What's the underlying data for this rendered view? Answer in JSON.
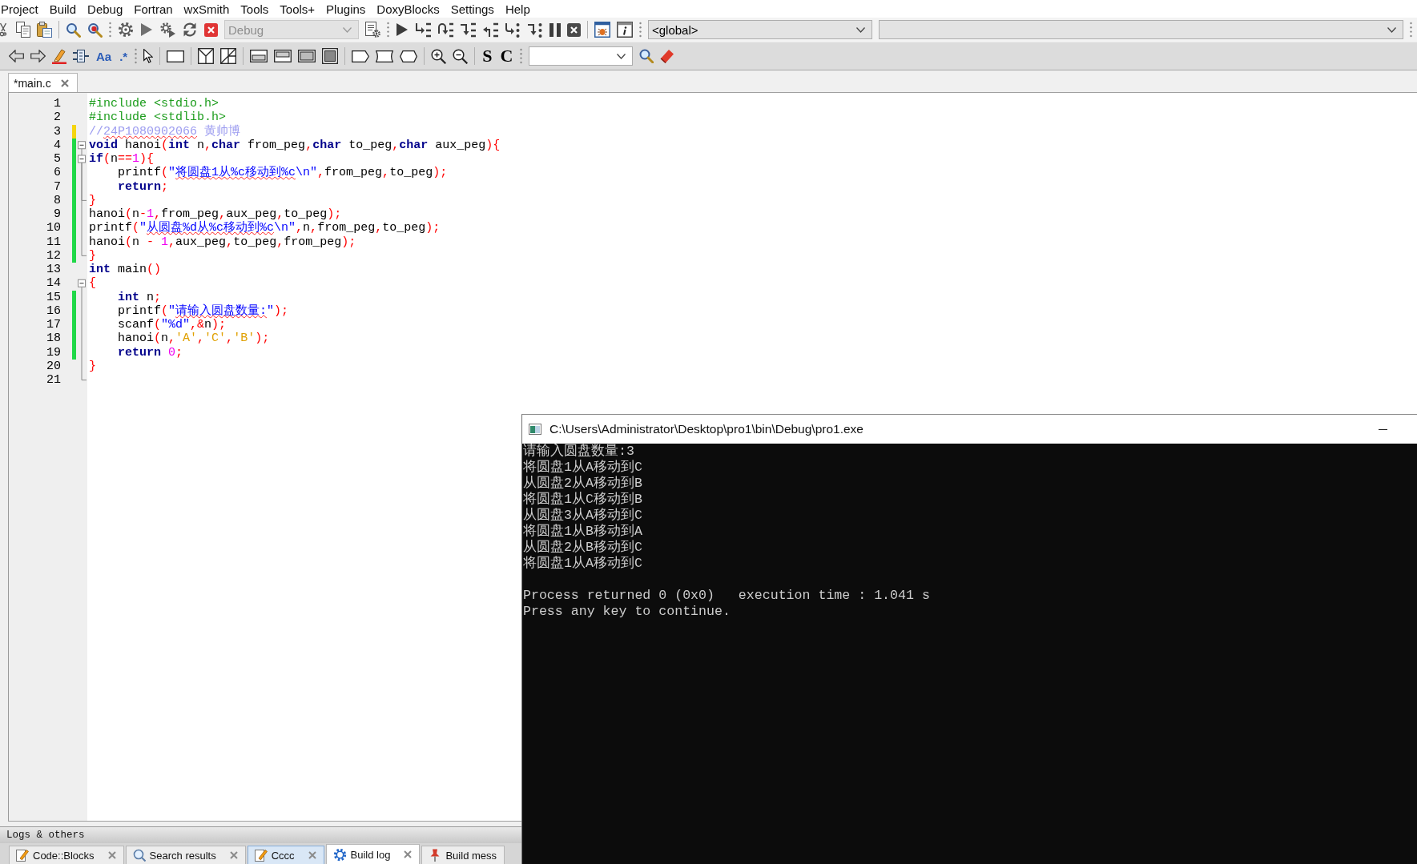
{
  "menu_bar": {
    "items": [
      "Project",
      "Build",
      "Debug",
      "Fortran",
      "wxSmith",
      "Tools",
      "Tools+",
      "Plugins",
      "DoxyBlocks",
      "Settings",
      "Help"
    ]
  },
  "main_toolbar": {
    "build_target": {
      "value": "Debug",
      "disabled": true
    },
    "scope_dropdown": {
      "value": "<global>",
      "disabled": false
    }
  },
  "search_toolbar": {
    "text_buttons": [
      "Aa",
      ".*",
      "S",
      "C"
    ]
  },
  "editor_tabs": [
    {
      "label": "*main.c",
      "selected": true
    }
  ],
  "editor": {
    "lines": [
      {
        "number": "1",
        "kind": "plain",
        "tokens": [
          {
            "kind": "preprocessor",
            "text": "#include <stdio.h>",
            "squiggle": false
          }
        ]
      },
      {
        "number": "2",
        "kind": "plain",
        "tokens": [
          {
            "kind": "preprocessor",
            "text": "#include <stdlib.h>",
            "squiggle": false
          }
        ]
      },
      {
        "number": "3",
        "kind": "plain",
        "change_bar": {
          "color": "#f5d50f"
        },
        "tokens": [
          {
            "kind": "comment",
            "text": "//",
            "squiggle": false
          },
          {
            "kind": "comment",
            "text": "24P1080902066",
            "squiggle": true
          },
          {
            "kind": "comment",
            "text": " 黄帅博",
            "squiggle": false
          }
        ]
      },
      {
        "number": "4",
        "kind": "opener",
        "change_bar": {
          "color": "#20d848"
        },
        "tokens": [
          {
            "kind": "keyword",
            "text": "void",
            "squiggle": false
          },
          {
            "kind": "plain",
            "text": " hanoi",
            "squiggle": false
          },
          {
            "kind": "operator",
            "text": "(",
            "squiggle": false
          },
          {
            "kind": "keyword",
            "text": "int",
            "squiggle": false
          },
          {
            "kind": "plain",
            "text": " n",
            "squiggle": false
          },
          {
            "kind": "operator",
            "text": ",",
            "squiggle": false
          },
          {
            "kind": "keyword",
            "text": "char",
            "squiggle": false
          },
          {
            "kind": "plain",
            "text": " from_peg",
            "squiggle": false
          },
          {
            "kind": "operator",
            "text": ",",
            "squiggle": false
          },
          {
            "kind": "keyword",
            "text": "char",
            "squiggle": false
          },
          {
            "kind": "plain",
            "text": " to_peg",
            "squiggle": false
          },
          {
            "kind": "operator",
            "text": ",",
            "squiggle": false
          },
          {
            "kind": "keyword",
            "text": "char",
            "squiggle": false
          },
          {
            "kind": "plain",
            "text": " aux_peg",
            "squiggle": false
          },
          {
            "kind": "operator",
            "text": "){",
            "squiggle": false
          }
        ]
      },
      {
        "number": "5",
        "kind": "opener",
        "change_bar": {
          "color": "#20d848"
        },
        "tokens": [
          {
            "kind": "keyword",
            "text": "if",
            "squiggle": false
          },
          {
            "kind": "operator",
            "text": "(",
            "squiggle": false
          },
          {
            "kind": "plain",
            "text": "n",
            "squiggle": false
          },
          {
            "kind": "operator",
            "text": "==",
            "squiggle": false
          },
          {
            "kind": "number",
            "text": "1",
            "squiggle": false
          },
          {
            "kind": "operator",
            "text": "){",
            "squiggle": false
          }
        ]
      },
      {
        "number": "6",
        "kind": "plain",
        "change_bar": {
          "color": "#20d848"
        },
        "tokens": [
          {
            "kind": "plain",
            "text": "    printf",
            "squiggle": false
          },
          {
            "kind": "operator",
            "text": "(",
            "squiggle": false
          },
          {
            "kind": "string",
            "text": "\"",
            "squiggle": false
          },
          {
            "kind": "string",
            "text": "将圆盘1从%c移动到%c",
            "squiggle": true
          },
          {
            "kind": "string",
            "text": "\\n\"",
            "squiggle": false
          },
          {
            "kind": "operator",
            "text": ",",
            "squiggle": false
          },
          {
            "kind": "plain",
            "text": "from_peg",
            "squiggle": false
          },
          {
            "kind": "operator",
            "text": ",",
            "squiggle": false
          },
          {
            "kind": "plain",
            "text": "to_peg",
            "squiggle": false
          },
          {
            "kind": "operator",
            "text": ");",
            "squiggle": false
          }
        ]
      },
      {
        "number": "7",
        "kind": "plain",
        "change_bar": {
          "color": "#20d848"
        },
        "tokens": [
          {
            "kind": "keyword",
            "text": "    return",
            "squiggle": false
          },
          {
            "kind": "operator",
            "text": ";",
            "squiggle": false
          }
        ]
      },
      {
        "number": "8",
        "kind": "closer",
        "change_bar": {
          "color": "#20d848"
        },
        "tokens": [
          {
            "kind": "operator",
            "text": "}",
            "squiggle": false
          }
        ]
      },
      {
        "number": "9",
        "kind": "plain",
        "change_bar": {
          "color": "#20d848"
        },
        "tokens": [
          {
            "kind": "plain",
            "text": "hanoi",
            "squiggle": false
          },
          {
            "kind": "operator",
            "text": "(",
            "squiggle": false
          },
          {
            "kind": "plain",
            "text": "n",
            "squiggle": false
          },
          {
            "kind": "operator",
            "text": "-",
            "squiggle": false
          },
          {
            "kind": "number",
            "text": "1",
            "squiggle": false
          },
          {
            "kind": "operator",
            "text": ",",
            "squiggle": false
          },
          {
            "kind": "plain",
            "text": "from_peg",
            "squiggle": false
          },
          {
            "kind": "operator",
            "text": ",",
            "squiggle": false
          },
          {
            "kind": "plain",
            "text": "aux_peg",
            "squiggle": false
          },
          {
            "kind": "operator",
            "text": ",",
            "squiggle": false
          },
          {
            "kind": "plain",
            "text": "to_peg",
            "squiggle": false
          },
          {
            "kind": "operator",
            "text": ");",
            "squiggle": false
          }
        ]
      },
      {
        "number": "10",
        "kind": "plain",
        "change_bar": {
          "color": "#20d848"
        },
        "tokens": [
          {
            "kind": "plain",
            "text": "printf",
            "squiggle": false
          },
          {
            "kind": "operator",
            "text": "(",
            "squiggle": false
          },
          {
            "kind": "string",
            "text": "\"",
            "squiggle": false
          },
          {
            "kind": "string",
            "text": "从圆盘%d从%c移动到%c",
            "squiggle": true
          },
          {
            "kind": "string",
            "text": "\\n\"",
            "squiggle": false
          },
          {
            "kind": "operator",
            "text": ",",
            "squiggle": false
          },
          {
            "kind": "plain",
            "text": "n",
            "squiggle": false
          },
          {
            "kind": "operator",
            "text": ",",
            "squiggle": false
          },
          {
            "kind": "plain",
            "text": "from_peg",
            "squiggle": false
          },
          {
            "kind": "operator",
            "text": ",",
            "squiggle": false
          },
          {
            "kind": "plain",
            "text": "to_peg",
            "squiggle": false
          },
          {
            "kind": "operator",
            "text": ");",
            "squiggle": false
          }
        ]
      },
      {
        "number": "11",
        "kind": "plain",
        "change_bar": {
          "color": "#20d848"
        },
        "tokens": [
          {
            "kind": "plain",
            "text": "hanoi",
            "squiggle": false
          },
          {
            "kind": "operator",
            "text": "(",
            "squiggle": false
          },
          {
            "kind": "plain",
            "text": "n ",
            "squiggle": false
          },
          {
            "kind": "operator",
            "text": "-",
            "squiggle": false
          },
          {
            "kind": "number",
            "text": " 1",
            "squiggle": false
          },
          {
            "kind": "operator",
            "text": ",",
            "squiggle": false
          },
          {
            "kind": "plain",
            "text": "aux_peg",
            "squiggle": false
          },
          {
            "kind": "operator",
            "text": ",",
            "squiggle": false
          },
          {
            "kind": "plain",
            "text": "to_peg",
            "squiggle": false
          },
          {
            "kind": "operator",
            "text": ",",
            "squiggle": false
          },
          {
            "kind": "plain",
            "text": "from_peg",
            "squiggle": false
          },
          {
            "kind": "operator",
            "text": ");",
            "squiggle": false
          }
        ]
      },
      {
        "number": "12",
        "kind": "closer",
        "change_bar": {
          "color": "#20d848"
        },
        "tokens": [
          {
            "kind": "operator",
            "text": "}",
            "squiggle": false
          }
        ]
      },
      {
        "number": "13",
        "kind": "plain",
        "tokens": [
          {
            "kind": "keyword",
            "text": "int",
            "squiggle": false
          },
          {
            "kind": "plain",
            "text": " main",
            "squiggle": false
          },
          {
            "kind": "operator",
            "text": "()",
            "squiggle": false
          }
        ]
      },
      {
        "number": "14",
        "kind": "opener",
        "tokens": [
          {
            "kind": "operator",
            "text": "{",
            "squiggle": false
          }
        ]
      },
      {
        "number": "15",
        "kind": "plain",
        "change_bar": {
          "color": "#20d848"
        },
        "tokens": [
          {
            "kind": "keyword",
            "text": "    int",
            "squiggle": false
          },
          {
            "kind": "plain",
            "text": " n",
            "squiggle": false
          },
          {
            "kind": "operator",
            "text": ";",
            "squiggle": false
          }
        ]
      },
      {
        "number": "16",
        "kind": "plain",
        "change_bar": {
          "color": "#20d848"
        },
        "tokens": [
          {
            "kind": "plain",
            "text": "    printf",
            "squiggle": false
          },
          {
            "kind": "operator",
            "text": "(",
            "squiggle": false
          },
          {
            "kind": "string",
            "text": "\"",
            "squiggle": false
          },
          {
            "kind": "string",
            "text": "请输入圆盘数量:",
            "squiggle": true
          },
          {
            "kind": "string",
            "text": "\"",
            "squiggle": false
          },
          {
            "kind": "operator",
            "text": ");",
            "squiggle": false
          }
        ]
      },
      {
        "number": "17",
        "kind": "plain",
        "change_bar": {
          "color": "#20d848"
        },
        "tokens": [
          {
            "kind": "plain",
            "text": "    scanf",
            "squiggle": false
          },
          {
            "kind": "operator",
            "text": "(",
            "squiggle": false
          },
          {
            "kind": "string",
            "text": "\"%d\"",
            "squiggle": false
          },
          {
            "kind": "operator",
            "text": ",&",
            "squiggle": false
          },
          {
            "kind": "plain",
            "text": "n",
            "squiggle": false
          },
          {
            "kind": "operator",
            "text": ");",
            "squiggle": false
          }
        ]
      },
      {
        "number": "18",
        "kind": "plain",
        "change_bar": {
          "color": "#20d848"
        },
        "tokens": [
          {
            "kind": "plain",
            "text": "    hanoi",
            "squiggle": false
          },
          {
            "kind": "operator",
            "text": "(",
            "squiggle": false
          },
          {
            "kind": "plain",
            "text": "n",
            "squiggle": false
          },
          {
            "kind": "operator",
            "text": ",",
            "squiggle": false
          },
          {
            "kind": "char",
            "text": "'A'",
            "squiggle": false
          },
          {
            "kind": "operator",
            "text": ",",
            "squiggle": false
          },
          {
            "kind": "char",
            "text": "'C'",
            "squiggle": false
          },
          {
            "kind": "operator",
            "text": ",",
            "squiggle": false
          },
          {
            "kind": "char",
            "text": "'B'",
            "squiggle": false
          },
          {
            "kind": "operator",
            "text": ");",
            "squiggle": false
          }
        ]
      },
      {
        "number": "19",
        "kind": "plain",
        "change_bar": {
          "color": "#20d848"
        },
        "tokens": [
          {
            "kind": "keyword",
            "text": "    return",
            "squiggle": false
          },
          {
            "kind": "number",
            "text": " 0",
            "squiggle": false
          },
          {
            "kind": "operator",
            "text": ";",
            "squiggle": false
          }
        ]
      },
      {
        "number": "20",
        "kind": "plain",
        "tokens": [
          {
            "kind": "operator",
            "text": "}",
            "squiggle": false
          }
        ]
      },
      {
        "number": "21",
        "kind": "closer"
      }
    ]
  },
  "logs_panel": {
    "title": "Logs & others",
    "tabs": [
      {
        "label": "Code::Blocks",
        "kind": "log",
        "selected": false,
        "hovered": false
      },
      {
        "label": "Search results",
        "kind": "search",
        "selected": false,
        "hovered": false
      },
      {
        "label": "Cccc",
        "kind": "log",
        "selected": false,
        "hovered": true
      },
      {
        "label": "Build log",
        "kind": "build",
        "selected": true,
        "hovered": false
      },
      {
        "label": "Build mess",
        "kind": "messages",
        "selected": false,
        "hovered": false
      }
    ]
  },
  "console_window": {
    "title": "C:\\Users\\Administrator\\Desktop\\pro1\\bin\\Debug\\pro1.exe",
    "output_lines": [
      "请输入圆盘数量:3",
      "将圆盘1从A移动到C",
      "从圆盘2从A移动到B",
      "将圆盘1从C移动到B",
      "从圆盘3从A移动到C",
      "将圆盘1从B移动到A",
      "从圆盘2从B移动到C",
      "将圆盘1从A移动到C"
    ],
    "status_lines": [
      "Process returned 0 (0x0)   execution time : 1.041 s",
      "Press any key to continue."
    ]
  }
}
